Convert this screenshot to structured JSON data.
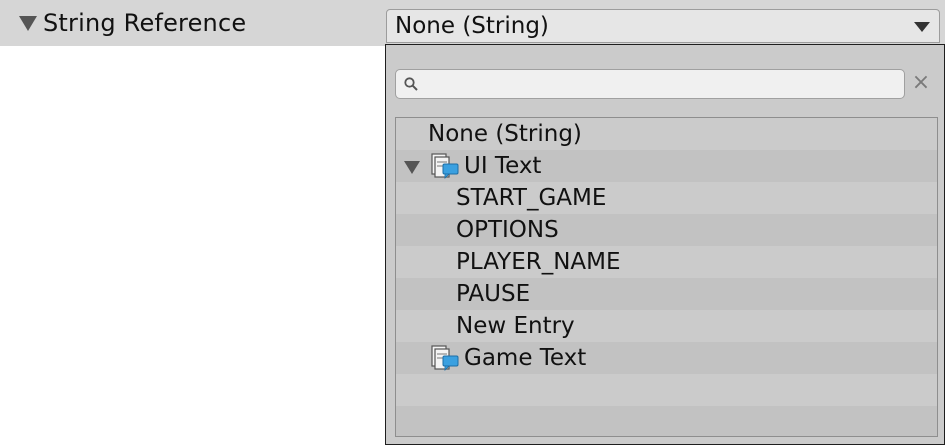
{
  "inspector": {
    "field_label": "String Reference",
    "field_value": "None (String)"
  },
  "dropdown": {
    "search": {
      "value": "",
      "placeholder": ""
    },
    "items": {
      "none": "None (String)",
      "ui_text": "UI Text",
      "start_game": "START_GAME",
      "options": "OPTIONS",
      "player_name": "PLAYER_NAME",
      "pause": "PAUSE",
      "new_entry": "New Entry",
      "game_text": "Game Text"
    }
  },
  "icons": {
    "foldout": "triangle-down-icon",
    "popup": "dropdown-arrow-icon",
    "search": "search-icon",
    "clear": "close-icon",
    "table": "string-table-icon"
  },
  "colors": {
    "header_bg": "#d6d6d6",
    "popup_bg": "#cbcbcb",
    "row_alt": "#c2c2c2",
    "icon_blue": "#3aa0e0"
  }
}
